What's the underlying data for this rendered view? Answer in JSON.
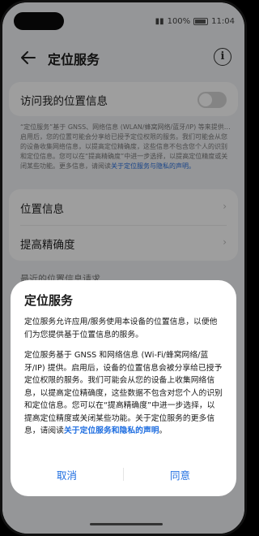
{
  "status_bar": {
    "battery_text": "100%",
    "time": "11:04"
  },
  "header": {
    "title": "定位服务",
    "info_glyph": "i"
  },
  "settings": {
    "access_location_label": "访问我的位置信息",
    "access_location_enabled": false,
    "description": "“定位服务”基于 GNSS、网络信息 (WLAN/蜂窝网络/蓝牙/IP) 等来提供…启用后，您的位置可能会分享给已授予定位权限的服务。我们可能会从您的设备收集网络信息，以提高定位精确度，这些信息不包含您个人的识别和定位信息。您可以在“提高精确度”中进一步选择，以提高定位精度或关闭某些功能。更多信息，请阅读",
    "description_link": "关于定位服务与隐私的声明。",
    "items": [
      {
        "label": "位置信息"
      },
      {
        "label": "提高精确度"
      }
    ],
    "recent_requests_label": "最近的位置信息请求"
  },
  "dialog": {
    "title": "定位服务",
    "paragraph1": "定位服务允许应用/服务使用本设备的位置信息，以便他们为您提供基于位置信息的服务。",
    "paragraph2": "定位服务基于 GNSS 和网络信息 (Wi-Fi/蜂窝网络/蓝牙/IP) 提供。启用后，设备的位置信息会被分享给已授予定位权限的服务。我们可能会从您的设备上收集网络信息，以提高定位精确度，这些数据不包含对您个人的识别和定位信息。您可以在“提高精确度”中进一步选择，以提高定位精度或关闭某些功能。关于定位服务的更多信息，请阅读",
    "paragraph2_link": "关于定位服务和隐私的声明",
    "paragraph2_end": "。",
    "cancel_label": "取消",
    "agree_label": "同意"
  },
  "colors": {
    "accent": "#1f6ee0",
    "background": "#f1f3f5",
    "dialog_bg": "#ffffff"
  }
}
